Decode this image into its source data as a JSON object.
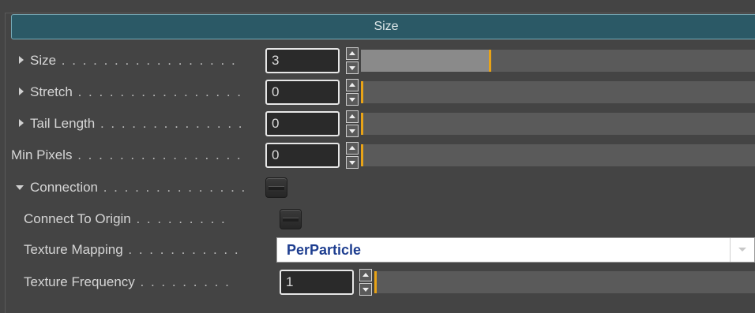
{
  "header": {
    "title": "Size"
  },
  "rows": [
    {
      "label": "Size",
      "dots": " . . . . . . . . . . . . . . . . .",
      "value": "3",
      "slider_fraction": 0.33
    },
    {
      "label": "Stretch",
      "dots": " . . . . . . . . . . . . . . . .",
      "value": "0",
      "slider_fraction": 0
    },
    {
      "label": "Tail Length",
      "dots": " . . . . . . . . . . . . . .",
      "value": "0",
      "slider_fraction": 0
    },
    {
      "label": "Min Pixels",
      "dots": " . . . . . . . . . . . . . . . .",
      "value": "0",
      "slider_fraction": 0
    },
    {
      "label": "Connection",
      "dots": " . . . . . . . . . . . . . .",
      "checked": false
    },
    {
      "label": "Connect To Origin",
      "dots": " . . . . . . . . .",
      "checked": false
    },
    {
      "label": "Texture Mapping",
      "dots": " . . . . . . . . . . .",
      "selected": "PerParticle"
    },
    {
      "label": "Texture Frequency",
      "dots": " . . . . . . . . .",
      "value": "1",
      "slider_fraction": 0
    }
  ],
  "colors": {
    "header_bg": "#2b5966",
    "header_border": "#76aab8",
    "slider_handle": "#e8a317",
    "dropdown_text": "#1d3d8f"
  },
  "icons": [
    "expand-arrow-icon",
    "collapse-arrow-icon",
    "spinner-up-icon",
    "spinner-down-icon",
    "dropdown-caret-icon"
  ]
}
